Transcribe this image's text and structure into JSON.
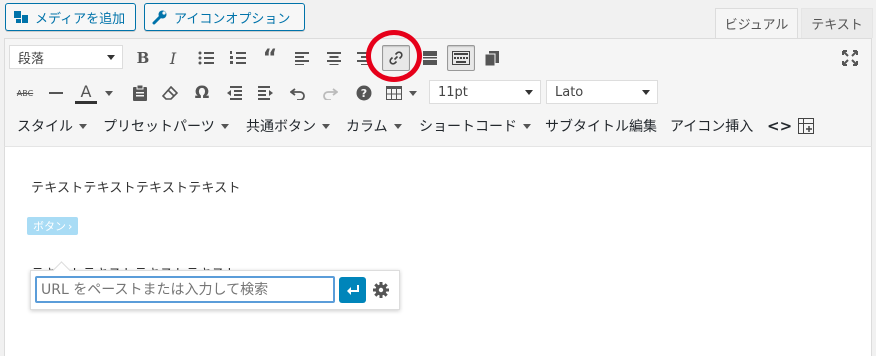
{
  "buttons": {
    "add_media": "メディアを追加",
    "icon_options": "アイコンオプション"
  },
  "tabs": {
    "visual": "ビジュアル",
    "text": "テキスト"
  },
  "toolbar": {
    "format_select": "段落",
    "font_size_select": "11pt",
    "font_family_select": "Lato",
    "strikethrough_label": "ABC",
    "text_color_label": "A",
    "menus": [
      "スタイル",
      "プリセットパーツ",
      "共通ボタン",
      "カラム",
      "ショートコード",
      "サブタイトル編集",
      "アイコン挿入"
    ]
  },
  "content": {
    "paragraph": "テキストテキストテキストテキスト",
    "button_pill": "ボタン"
  },
  "link_popup": {
    "placeholder": "URL をペーストまたは入力して検索"
  },
  "colors": {
    "accent": "#0073aa",
    "apply_button": "#0085ba",
    "highlight_circle": "#e6001a",
    "pill": "#a9dcf5"
  }
}
